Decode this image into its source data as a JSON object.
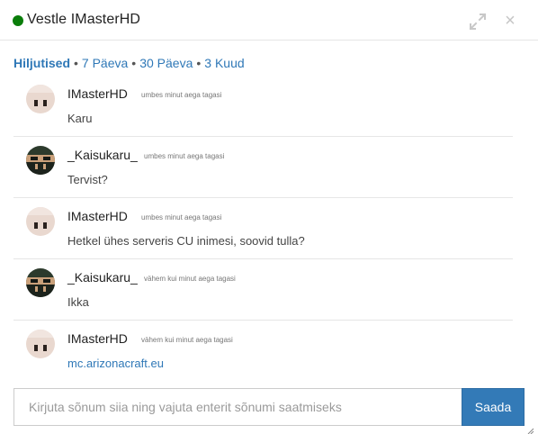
{
  "header": {
    "title": "Vestle IMasterHD",
    "status_color": "#0a7d0a",
    "icons": [
      "expand-icon",
      "close-icon"
    ]
  },
  "filters": [
    {
      "label": "Hiljutised",
      "active": true
    },
    {
      "label": "7 Päeva",
      "active": false
    },
    {
      "label": "30 Päeva",
      "active": false
    },
    {
      "label": "3 Kuud",
      "active": false
    }
  ],
  "messages": [
    {
      "author": "IMasterHD",
      "time": "umbes minut aega tagasi",
      "text": "Karu",
      "avatar": "light-skin-avatar"
    },
    {
      "author": "_Kaisukaru_",
      "time": "umbes minut aega tagasi",
      "text": "Tervist?",
      "avatar": "dark-masked-avatar"
    },
    {
      "author": "IMasterHD",
      "time": "umbes minut aega tagasi",
      "text": "Hetkel ühes serveris CU inimesi, soovid tulla?",
      "avatar": "light-skin-avatar"
    },
    {
      "author": "_Kaisukaru_",
      "time": "vähem kui minut aega tagasi",
      "text": "Ikka",
      "avatar": "dark-masked-avatar"
    },
    {
      "author": "IMasterHD",
      "time": "vähem kui minut aega tagasi",
      "text": "mc.arizonacraft.eu",
      "avatar": "light-skin-avatar",
      "is_link": true
    }
  ],
  "composer": {
    "placeholder": "Kirjuta sõnum siia ning vajuta enterit sõnumi saatmiseks",
    "send_label": "Saada"
  },
  "colors": {
    "accent": "#337ab7",
    "link": "#2f78b7"
  }
}
